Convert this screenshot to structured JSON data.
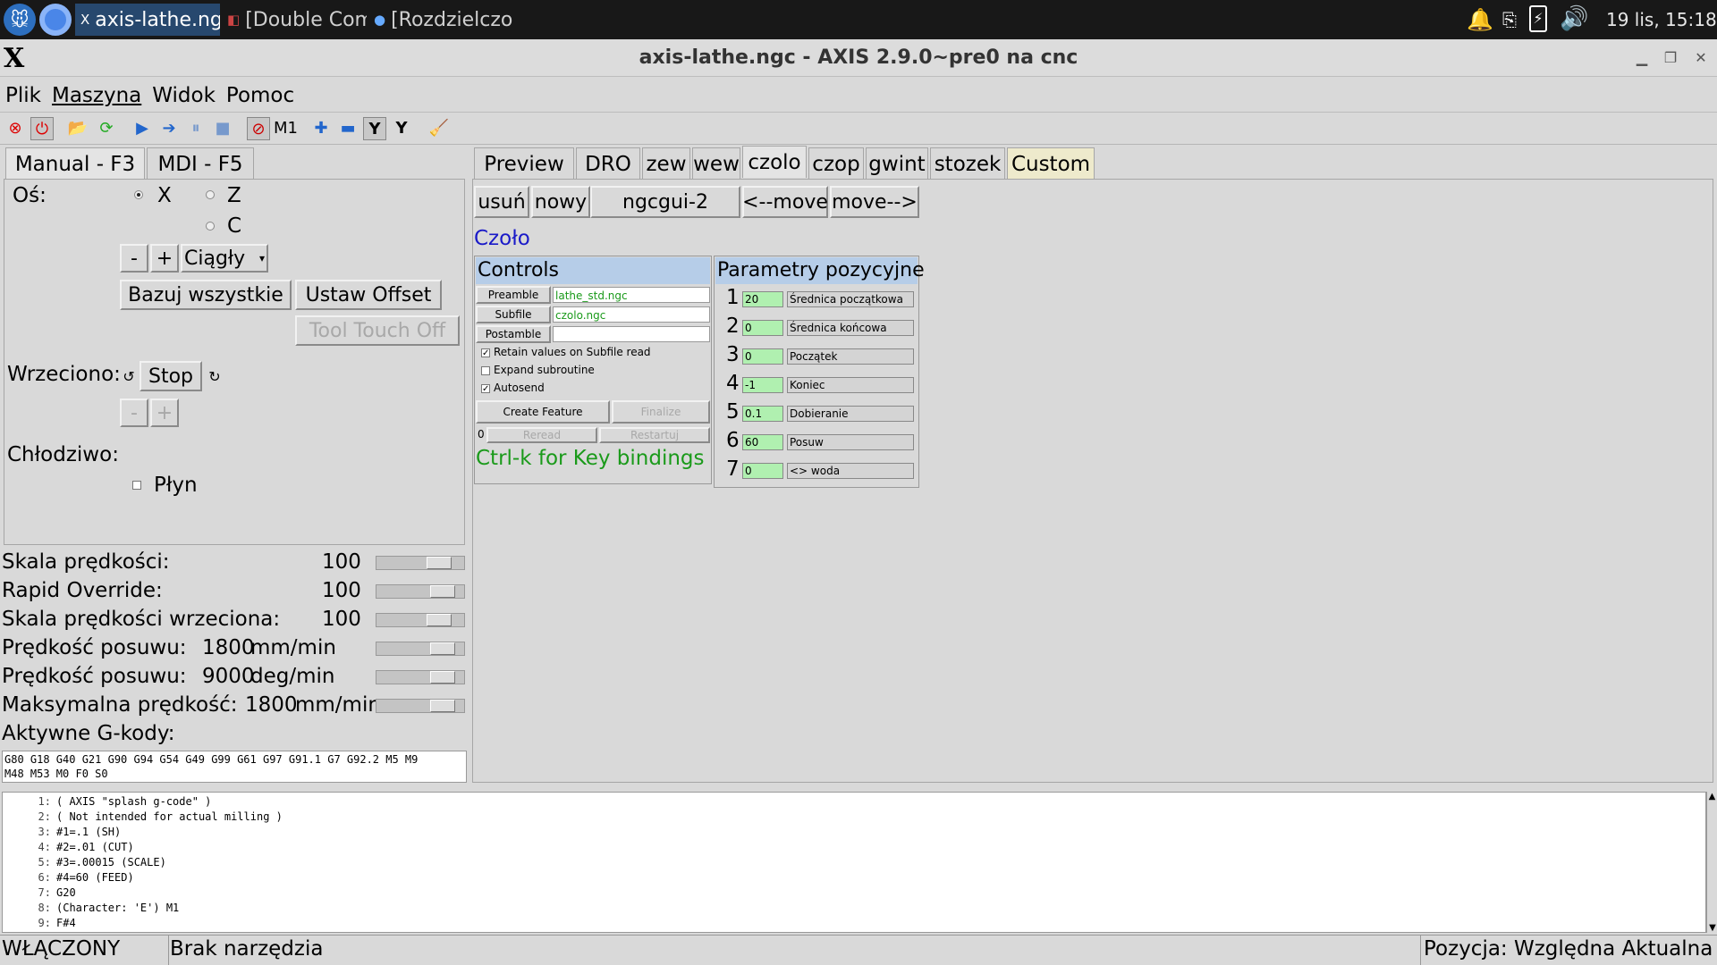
{
  "taskbar": {
    "tasks": [
      "axis-lathe.ngc -...",
      "[Double Comm...",
      "[Rozdzielczość ..."
    ],
    "clock": "19 lis, 15:18"
  },
  "window": {
    "title": "axis-lathe.ngc - AXIS 2.9.0~pre0 na cnc",
    "logo": "X"
  },
  "menu": [
    "Plik",
    "Maszyna",
    "Widok",
    "Pomoc"
  ],
  "left": {
    "tabs": [
      "Manual - F3",
      "MDI - F5"
    ],
    "axis_label": "Oś:",
    "axes": [
      "X",
      "Z",
      "C"
    ],
    "jog_minus": "-",
    "jog_plus": "+",
    "jog_mode": "Ciągły",
    "home_all": "Bazuj wszystkie",
    "touch_off": "Ustaw Offset",
    "tool_touch_off": "Tool Touch Off",
    "spindle_label": "Wrzeciono:",
    "spindle_stop": "Stop",
    "spindle_minus": "-",
    "spindle_plus": "+",
    "coolant_label": "Chłodziwo:",
    "flood": "Płyn"
  },
  "overrides": [
    {
      "label": "Skala prędkości:",
      "value": "100",
      "unit": "",
      "level": 0.8
    },
    {
      "label": "Rapid Override:",
      "value": "100",
      "unit": "",
      "level": 0.85
    },
    {
      "label": "Skala prędkości wrzeciona:",
      "value": "100",
      "unit": "",
      "level": 0.8
    },
    {
      "label": "Prędkość posuwu:",
      "value": "1800",
      "unit": "mm/min",
      "level": 0.85
    },
    {
      "label": "Prędkość posuwu:",
      "value": "9000",
      "unit": "deg/min",
      "level": 0.85
    },
    {
      "label": "Maksymalna prędkość:",
      "value": "1800",
      "unit": "mm/min",
      "level": 0.85
    }
  ],
  "gcodes": {
    "label": "Aktywne G-kody:",
    "line1": "G80 G18 G40 G21 G90 G94 G54 G49 G99 G61 G97 G91.1 G7 G92.2 M5 M9",
    "line2": "M48 M53 M0 F0 S0"
  },
  "right": {
    "tabs": [
      "Preview",
      "DRO",
      "zew",
      "wew",
      "czolo",
      "czop",
      "gwint",
      "stozek",
      "Custom"
    ],
    "page_buttons": [
      "usuń",
      "nowy",
      "ngcgui-2",
      "<--move",
      "move-->"
    ],
    "feature_title": "Czoło",
    "controls": {
      "header": "Controls",
      "preamble_btn": "Preamble",
      "preamble_val": "lathe_std.ngc",
      "subfile_btn": "Subfile",
      "subfile_val": "czolo.ngc",
      "postamble_btn": "Postamble",
      "postamble_val": "",
      "retain": "Retain values on Subfile read",
      "expand": "Expand subroutine",
      "autosend": "Autosend",
      "create": "Create Feature",
      "finalize": "Finalize",
      "counter": "0",
      "reread": "Reread",
      "restart": "Restartuj",
      "hint": "Ctrl-k for Key bindings"
    },
    "params": {
      "header": "Parametry pozycyjne",
      "rows": [
        {
          "num": "1",
          "value": "20",
          "name": "Średnica początkowa"
        },
        {
          "num": "2",
          "value": "0",
          "name": "Średnica końcowa"
        },
        {
          "num": "3",
          "value": "0",
          "name": "Początek"
        },
        {
          "num": "4",
          "value": "-1",
          "name": "Koniec"
        },
        {
          "num": "5",
          "value": "0.1",
          "name": "Dobieranie"
        },
        {
          "num": "6",
          "value": "60",
          "name": "Posuw"
        },
        {
          "num": "7",
          "value": "0",
          "name": "<> woda"
        }
      ]
    }
  },
  "gcode_listing": [
    {
      "n": "1:",
      "text": "( AXIS \"splash g-code\" )"
    },
    {
      "n": "2:",
      "text": "( Not intended for actual milling )"
    },
    {
      "n": "3:",
      "text": "#1=.1 (SH)"
    },
    {
      "n": "4:",
      "text": "#2=.01 (CUT)"
    },
    {
      "n": "5:",
      "text": "#3=.00015 (SCALE)"
    },
    {
      "n": "6:",
      "text": "#4=60 (FEED)"
    },
    {
      "n": "7:",
      "text": "G20"
    },
    {
      "n": "8:",
      "text": "(Character: 'E') M1"
    },
    {
      "n": "9:",
      "text": "F#4"
    }
  ],
  "status": {
    "state": "WŁĄCZONY",
    "tool": "Brak narzędzia",
    "position": "Pozycja: Względna Aktualna"
  }
}
